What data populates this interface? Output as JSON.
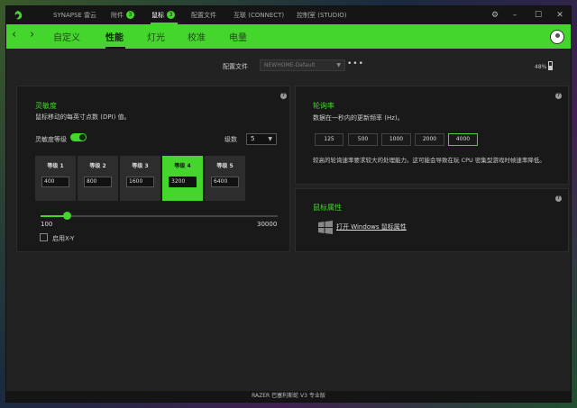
{
  "titlebar": {
    "nav": [
      {
        "label": "SYNAPSE 雷云",
        "badge": null
      },
      {
        "label": "附件",
        "badge": "3"
      },
      {
        "label": "鼠标",
        "badge": "3"
      },
      {
        "label": "配置文件",
        "badge": null
      },
      {
        "label": "互联 (CONNECT)",
        "badge": null
      },
      {
        "label": "控制室 (STUDIO)",
        "badge": null
      }
    ],
    "active_nav": "鼠标"
  },
  "subnav": {
    "tabs": [
      "自定义",
      "性能",
      "灯光",
      "校准",
      "电量"
    ],
    "active_tab": "性能"
  },
  "profile": {
    "label": "配置文件",
    "value": "NEWHOME-Default"
  },
  "battery": {
    "percent": "48%"
  },
  "sensitivity": {
    "title": "灵敏度",
    "description": "鼠标移动的每英寸点数 (DPI) 值。",
    "stages_toggle_label": "灵敏度等级",
    "stages_toggle_on": true,
    "stages_count_label": "级数",
    "stages_count": "5",
    "stages": [
      {
        "label": "等级 1",
        "value": "400"
      },
      {
        "label": "等级 2",
        "value": "800"
      },
      {
        "label": "等级 3",
        "value": "1600"
      },
      {
        "label": "等级 4",
        "value": "3200"
      },
      {
        "label": "等级 5",
        "value": "6400"
      }
    ],
    "active_stage": 4,
    "slider_min": "100",
    "slider_max": "30000",
    "xy_label": "启用X-Y"
  },
  "polling": {
    "title": "轮询率",
    "description": "数据在一秒内的更新频率 (Hz)。",
    "options": [
      "125",
      "500",
      "1000",
      "2000",
      "4000"
    ],
    "selected": "4000",
    "note": "较高的轮询速率要求较大的处理能力。这可能会导致在玩 CPU 密集型游戏时帧速率降低。"
  },
  "mouse_props": {
    "title": "鼠标属性",
    "link": "打开 Windows 鼠标属性"
  },
  "footer": {
    "device": "RAZER 巴塞利斯蛇 V3 专业版"
  },
  "colors": {
    "accent": "#44d62c",
    "panel": "#191919",
    "background": "#222222"
  }
}
